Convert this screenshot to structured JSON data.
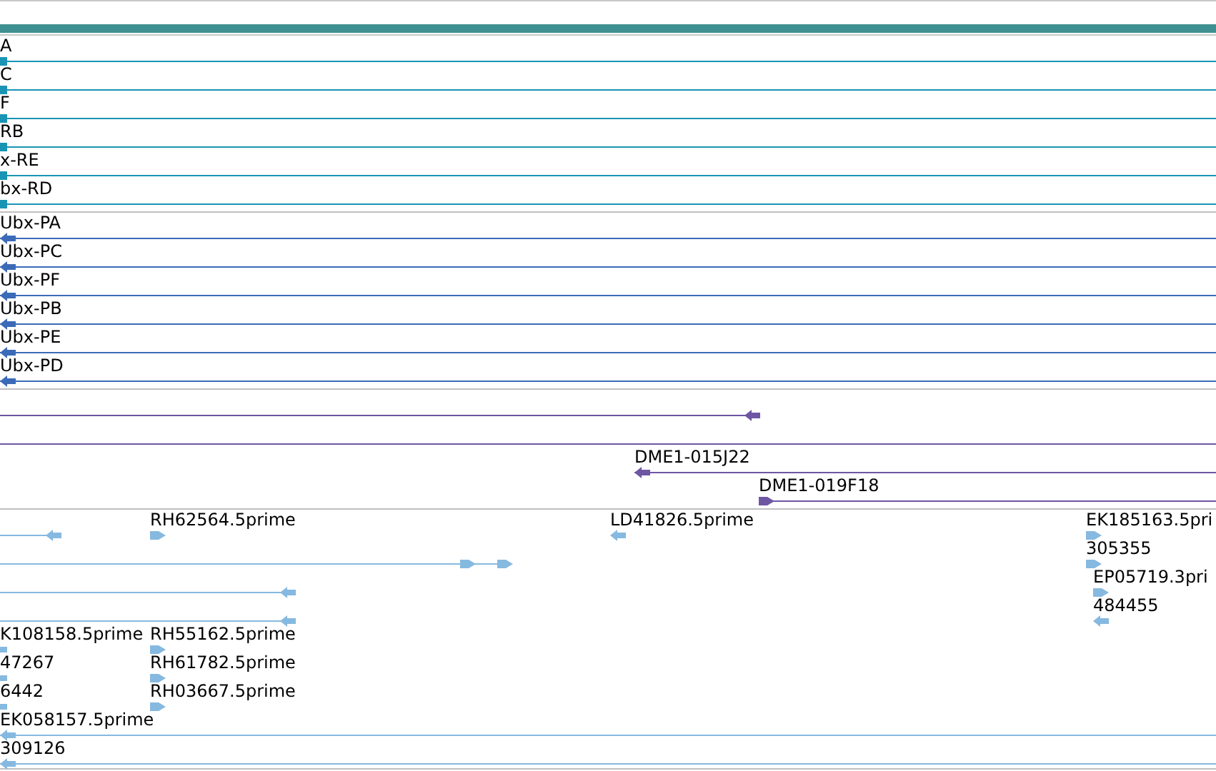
{
  "header": {
    "color": "#3f9090"
  },
  "tracks": [
    {
      "color": "#1a94b4",
      "features": [
        {
          "label": "A",
          "kind": "box"
        },
        {
          "label": "C",
          "kind": "box"
        },
        {
          "label": "F",
          "kind": "box"
        },
        {
          "label": "RB",
          "kind": "box"
        },
        {
          "label": "x-RE",
          "kind": "box"
        },
        {
          "label": "bx-RD",
          "kind": "box"
        }
      ]
    },
    {
      "color": "#3b6bb8",
      "features": [
        {
          "label": "Ubx-PA",
          "kind": "reverse"
        },
        {
          "label": "Ubx-PC",
          "kind": "reverse"
        },
        {
          "label": "Ubx-PF",
          "kind": "reverse"
        },
        {
          "label": "Ubx-PB",
          "kind": "reverse"
        },
        {
          "label": "Ubx-PE",
          "kind": "reverse"
        },
        {
          "label": "Ubx-PD",
          "kind": "reverse"
        }
      ]
    },
    {
      "color": "#6e56a3",
      "features": [
        {
          "kind": "reverse"
        },
        {
          "kind": "plain"
        },
        {
          "label": "DME1-015J22",
          "kind": "reverse"
        },
        {
          "label": "DME1-019F18",
          "kind": "forward"
        }
      ]
    },
    {
      "color": "#86b9e0",
      "features": [
        {
          "kind": "reverse"
        },
        {
          "label": "RH62564.5prime",
          "kind": "forward"
        },
        {
          "label": "LD41826.5prime",
          "kind": "reverse"
        },
        {
          "label": "EK185163.5pri",
          "kind": "forward"
        },
        {
          "kind": "forward"
        },
        {
          "label": "305355",
          "kind": "forward"
        },
        {
          "kind": "reverse"
        },
        {
          "label": "EP05719.3pri",
          "kind": "forward"
        },
        {
          "kind": "reverse"
        },
        {
          "label": "484455",
          "kind": "reverse"
        },
        {
          "label": "K108158.5prime",
          "kind": "reverse"
        },
        {
          "label": "RH55162.5prime",
          "kind": "forward"
        },
        {
          "label": "47267",
          "kind": "reverse"
        },
        {
          "label": "RH61782.5prime",
          "kind": "forward"
        },
        {
          "label": "6442",
          "kind": "reverse"
        },
        {
          "label": "RH03667.5prime",
          "kind": "forward"
        },
        {
          "label": "EK058157.5prime",
          "kind": "reverse"
        },
        {
          "label": "309126",
          "kind": "reverse"
        }
      ]
    }
  ]
}
